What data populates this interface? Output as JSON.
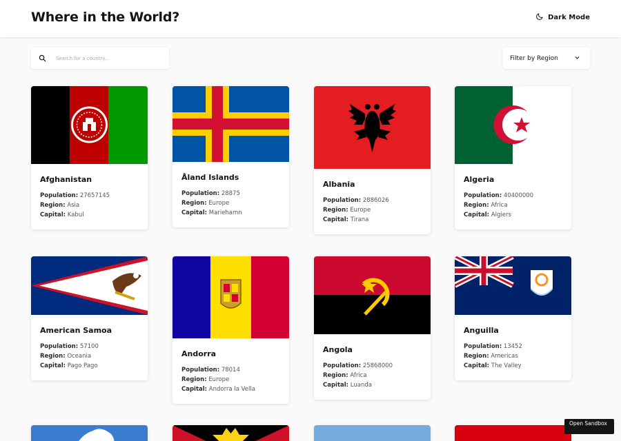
{
  "header": {
    "title": "Where in the World?",
    "dark_mode_label": "Dark Mode"
  },
  "search": {
    "placeholder": "Search for a country..."
  },
  "filter": {
    "label": "Filter by Region"
  },
  "field_labels": {
    "population": "Population:",
    "region": "Region:",
    "capital": "Capital:"
  },
  "countries": [
    {
      "name": "Afghanistan",
      "population": "27657145",
      "region": "Asia",
      "capital": "Kabul"
    },
    {
      "name": "Åland Islands",
      "population": "28875",
      "region": "Europe",
      "capital": "Mariehamn"
    },
    {
      "name": "Albania",
      "population": "2886026",
      "region": "Europe",
      "capital": "Tirana"
    },
    {
      "name": "Algeria",
      "population": "40400000",
      "region": "Africa",
      "capital": "Algiers"
    },
    {
      "name": "American Samoa",
      "population": "57100",
      "region": "Oceania",
      "capital": "Pago Pago"
    },
    {
      "name": "Andorra",
      "population": "78014",
      "region": "Europe",
      "capital": "Andorra la Vella"
    },
    {
      "name": "Angola",
      "population": "25868000",
      "region": "Africa",
      "capital": "Luanda"
    },
    {
      "name": "Anguilla",
      "population": "13452",
      "region": "Americas",
      "capital": "The Valley"
    }
  ],
  "sandbox": {
    "label": "Open Sandbox"
  },
  "colors": {
    "background": "#fafafa",
    "text": "#111517",
    "card": "#ffffff"
  },
  "icons": {
    "dark_mode": "moon-icon",
    "search": "search-icon",
    "filter": "chevron-down-icon"
  }
}
